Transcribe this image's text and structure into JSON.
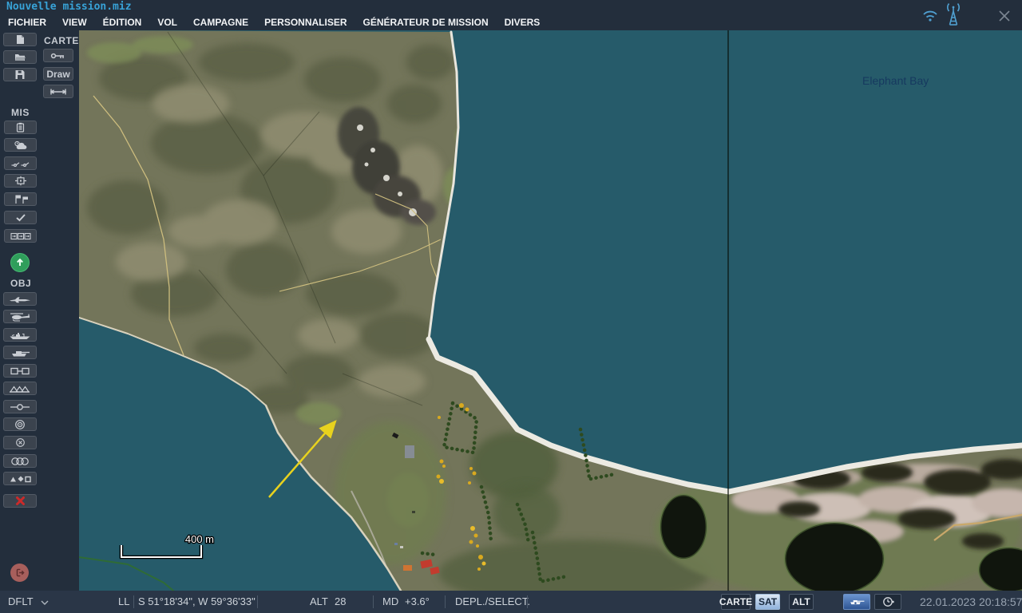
{
  "window": {
    "title": "Nouvelle mission.miz"
  },
  "menu": {
    "items": [
      "FICHIER",
      "VIEW",
      "ÉDITION",
      "VOL",
      "CAMPAGNE",
      "PERSONNALISER",
      "GÉNÉRATEUR DE MISSION",
      "DIVERS"
    ]
  },
  "topbar": {
    "icons": [
      "wifi-icon",
      "radio-tower-icon",
      "close-icon"
    ]
  },
  "toolbar": {
    "carte_label": "CARTE",
    "draw_label": "Draw",
    "mis_label": "MIS",
    "obj_label": "OBJ",
    "file_buttons": [
      "new-mission",
      "open-mission",
      "save-mission"
    ],
    "carte_buttons": [
      "map-options-key",
      "draw",
      "measure-distance"
    ],
    "mis_buttons": [
      "briefing",
      "weather",
      "triggers",
      "trigger-zone",
      "flags",
      "goals",
      "sequence",
      "fly-mission"
    ],
    "obj_buttons": [
      "airplane",
      "helicopter",
      "ship",
      "vehicle",
      "static-object",
      "fortification",
      "waypoint",
      "bullseye",
      "zone",
      "unit-groups",
      "shapes",
      "delete"
    ]
  },
  "map": {
    "bay_label": "Elephant Bay",
    "scale_label": "400 m",
    "colors": {
      "sea": "#265b6a",
      "land": "#73755a",
      "beach": "#ece9e0",
      "arrow": "#e8d21e"
    }
  },
  "statusbar": {
    "profile": "DFLT",
    "coord_mode": "LL",
    "coords": "S 51°18'34\", W 59°36'33\"",
    "alt_label": "ALT",
    "alt_value": "28",
    "md_label": "MD",
    "md_value": "+3.6°",
    "mode": "DEPL./SELECT.",
    "map_buttons": [
      "CARTE",
      "SAT",
      "ALT"
    ],
    "datetime": "22.01.2023 20:18:57"
  }
}
